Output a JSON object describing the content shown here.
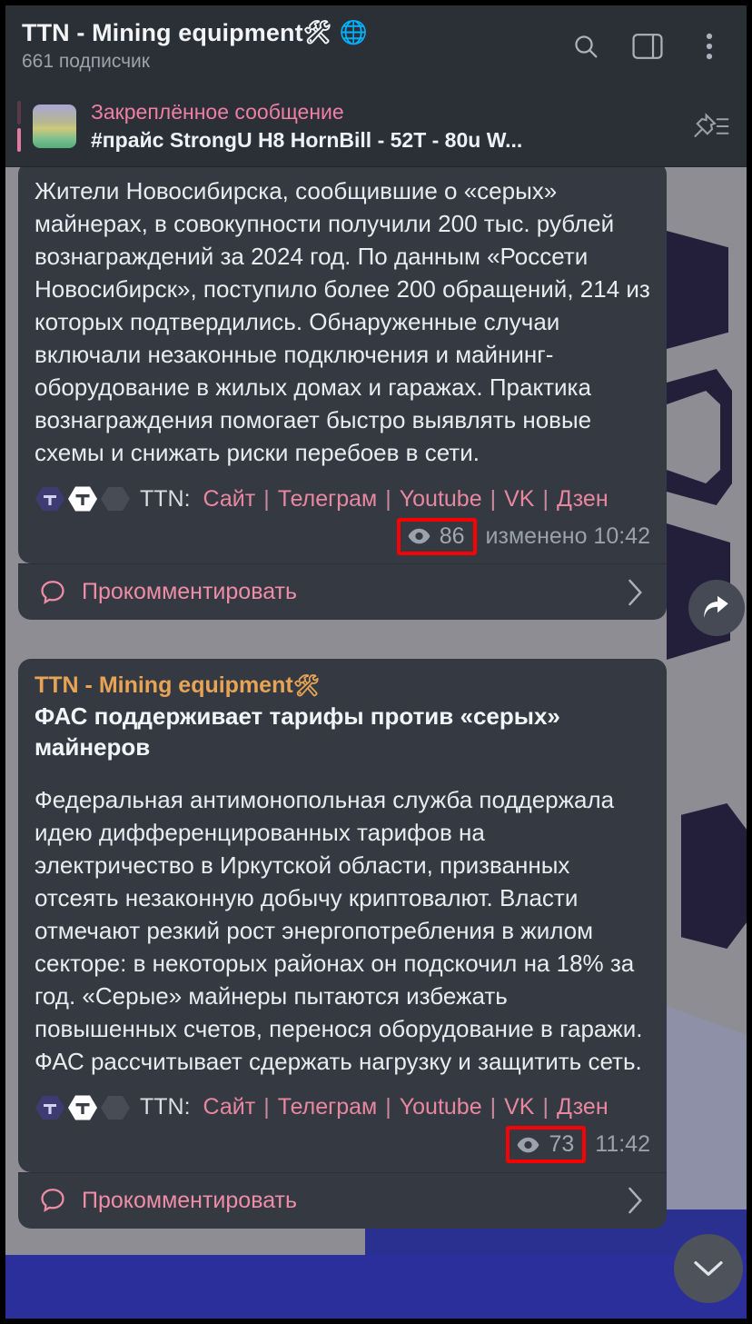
{
  "app": "telegram-channel",
  "header": {
    "title": "TTN - Mining equipment",
    "title_emoji_tools": "🛠",
    "title_emoji_globe": "🌐",
    "subscribers": "661 подписчик",
    "icons": {
      "search": "search-icon",
      "panel": "sidebar-panel-icon",
      "menu": "more-vertical-icon"
    }
  },
  "pinned": {
    "label": "Закреплённое сообщение",
    "message": "#прайс  StrongU H8 HornBill - 52T - 80u  W...",
    "icon": "pin-list-icon"
  },
  "messages": [
    {
      "id": "msg-1",
      "text": "Жители Новосибирска, сообщившие о «серых» майнерах, в совокупности получили 200 тыс. рублей вознаграждений за 2024 год. По данным «Россети Новосибирск», поступило более 200 обращений, 214 из которых подтвердились. Обнаруженные случаи включали незаконные подключения и майнинг-оборудование в жилых домах и гаражах. Практика вознаграждения помогает быстро выявлять новые схемы и снижать риски перебоев в сети.",
      "signature_label": "TTN:",
      "links": [
        "Сайт",
        "Телеграм",
        "Youtube",
        "VK",
        "Дзен"
      ],
      "separator": "|",
      "views": "86",
      "edited_time": "изменено 10:42",
      "comment_label": "Прокомментировать",
      "views_highlighted": true
    },
    {
      "id": "msg-2",
      "channel": "TTN - Mining equipment",
      "channel_emoji": "🛠",
      "headline": "ФАС поддерживает тарифы против «серых» майнеров",
      "text": "Федеральная антимонопольная служба поддержала идею дифференцированных тарифов на электричество в Иркутской области, призванных отсеять незаконную добычу криптовалют. Власти отмечают резкий рост энергопотребления в жилом секторе: в некоторых районах он подскочил на 18% за год. «Серые» майнеры пытаются избежать повышенных счетов, перенося оборудование в гаражи. ФАС рассчитывает сдержать нагрузку и защитить сеть.",
      "signature_label": "TTN:",
      "links": [
        "Сайт",
        "Телеграм",
        "Youtube",
        "VK",
        "Дзен"
      ],
      "separator": "|",
      "views": "73",
      "edited_time": "11:42",
      "comment_label": "Прокомментировать",
      "views_highlighted": true
    }
  ],
  "floating": {
    "share": "share-forward-icon",
    "scroll_down": "chevron-down-icon"
  },
  "colors": {
    "accent_pink": "#ef7fa4",
    "channel_orange": "#e8a454",
    "bubble": "#353a42",
    "header": "#2b2f36",
    "highlight_red": "#fb0000",
    "wallpaper_gray": "#8d8d93",
    "wallpaper_dark": "#231f3b",
    "bottom_blue": "#2a2f9b"
  }
}
